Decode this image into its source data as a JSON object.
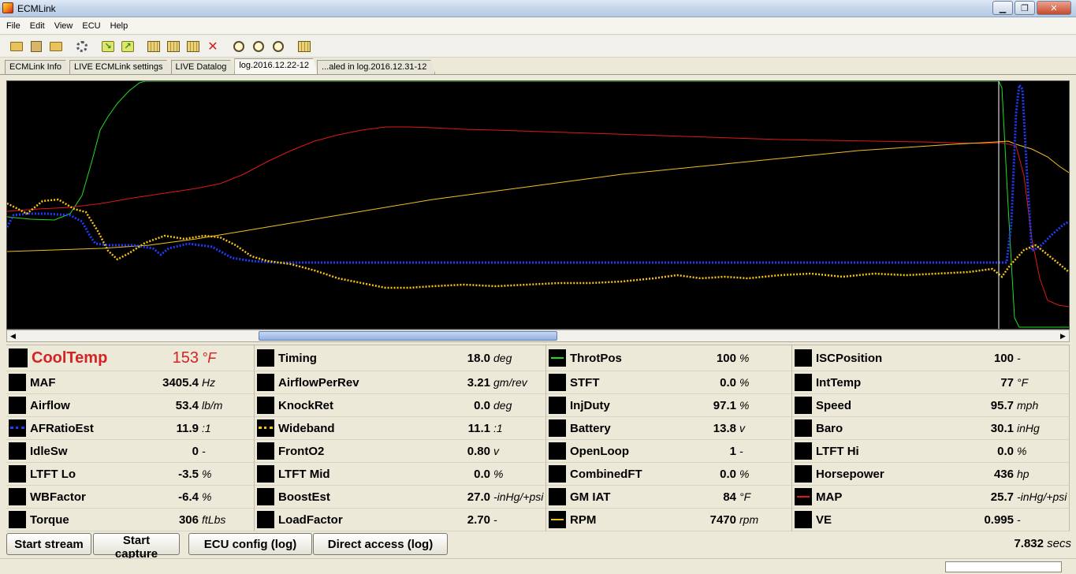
{
  "window": {
    "title": "ECMLink"
  },
  "menu": [
    {
      "label": "File"
    },
    {
      "label": "Edit"
    },
    {
      "label": "View"
    },
    {
      "label": "ECU"
    },
    {
      "label": "Help"
    }
  ],
  "toolbar": {
    "stop_glyph": "✕"
  },
  "tabs": [
    {
      "label": "ECMLink Info"
    },
    {
      "label": "LIVE ECMLink settings"
    },
    {
      "label": "LIVE Datalog"
    },
    {
      "label": "log.2016.12.22-12"
    },
    {
      "label": "...aled in log.2016.12.31-12"
    }
  ],
  "active_tab": 3,
  "colors": {
    "plot_bg": "#000000",
    "coolant": "#d32424",
    "throttle": "#22dd22",
    "rpm": "#f0c020",
    "map": "#e01818",
    "afr": "#1f3cff",
    "wideband": "#f7c31a",
    "cursor": "#ffffff"
  },
  "scrollbar": {
    "left": "◀",
    "right": "▶",
    "position": 0.23,
    "visible_fraction": 0.36
  },
  "params": {
    "c0": [
      {
        "name": "CoolTemp",
        "value": "153",
        "unit": "°F"
      },
      {
        "name": "MAF",
        "value": "3405.4",
        "unit": "Hz"
      },
      {
        "name": "Airflow",
        "value": "53.4",
        "unit": "lb/m"
      },
      {
        "name": "AFRatioEst",
        "value": "11.9",
        "unit": ":1"
      },
      {
        "name": "IdleSw",
        "value": "0",
        "unit": "-"
      },
      {
        "name": "LTFT Lo",
        "value": "-3.5",
        "unit": "%"
      },
      {
        "name": "WBFactor",
        "value": "-6.4",
        "unit": "%"
      },
      {
        "name": "Torque",
        "value": "306",
        "unit": "ftLbs"
      }
    ],
    "c1": [
      {
        "name": "Timing",
        "value": "18.0",
        "unit": "deg"
      },
      {
        "name": "AirflowPerRev",
        "value": "3.21",
        "unit": "gm/rev"
      },
      {
        "name": "KnockRet",
        "value": "0.0",
        "unit": "deg"
      },
      {
        "name": "Wideband",
        "value": "11.1",
        "unit": ":1"
      },
      {
        "name": "FrontO2",
        "value": "0.80",
        "unit": "v"
      },
      {
        "name": "LTFT Mid",
        "value": "0.0",
        "unit": "%"
      },
      {
        "name": "BoostEst",
        "value": "27.0",
        "unit": "-inHg/+psi"
      },
      {
        "name": "LoadFactor",
        "value": "2.70",
        "unit": "-"
      }
    ],
    "c2": [
      {
        "name": "ThrotPos",
        "value": "100",
        "unit": "%"
      },
      {
        "name": "STFT",
        "value": "0.0",
        "unit": "%"
      },
      {
        "name": "InjDuty",
        "value": "97.1",
        "unit": "%"
      },
      {
        "name": "Battery",
        "value": "13.8",
        "unit": "v"
      },
      {
        "name": "OpenLoop",
        "value": "1",
        "unit": "-"
      },
      {
        "name": "CombinedFT",
        "value": "0.0",
        "unit": "%"
      },
      {
        "name": "GM IAT",
        "value": "84",
        "unit": "°F"
      },
      {
        "name": "RPM",
        "value": "7470",
        "unit": "rpm"
      }
    ],
    "c3": [
      {
        "name": "ISCPosition",
        "value": "100",
        "unit": "-"
      },
      {
        "name": "IntTemp",
        "value": "77",
        "unit": "°F"
      },
      {
        "name": "Speed",
        "value": "95.7",
        "unit": "mph"
      },
      {
        "name": "Baro",
        "value": "30.1",
        "unit": "inHg"
      },
      {
        "name": "LTFT Hi",
        "value": "0.0",
        "unit": "%"
      },
      {
        "name": "Horsepower",
        "value": "436",
        "unit": "hp"
      },
      {
        "name": "MAP",
        "value": "25.7",
        "unit": "-inHg/+psi"
      },
      {
        "name": "VE",
        "value": "0.995",
        "unit": "-"
      }
    ]
  },
  "buttons": {
    "start_stream": "Start stream",
    "start_capture": "Start capture",
    "ecu_config": "ECU config (log)",
    "direct_access": "Direct access (log)"
  },
  "elapsed": {
    "value": "7.832",
    "unit": "secs"
  }
}
